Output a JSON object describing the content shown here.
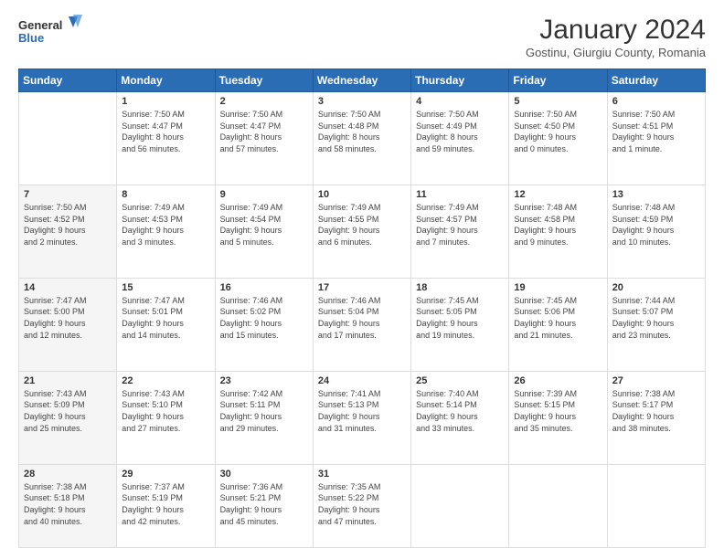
{
  "logo": {
    "line1": "General",
    "line2": "Blue"
  },
  "header": {
    "title": "January 2024",
    "subtitle": "Gostinu, Giurgiu County, Romania"
  },
  "weekdays": [
    "Sunday",
    "Monday",
    "Tuesday",
    "Wednesday",
    "Thursday",
    "Friday",
    "Saturday"
  ],
  "weeks": [
    [
      {
        "day": "",
        "info": ""
      },
      {
        "day": "1",
        "info": "Sunrise: 7:50 AM\nSunset: 4:47 PM\nDaylight: 8 hours\nand 56 minutes."
      },
      {
        "day": "2",
        "info": "Sunrise: 7:50 AM\nSunset: 4:47 PM\nDaylight: 8 hours\nand 57 minutes."
      },
      {
        "day": "3",
        "info": "Sunrise: 7:50 AM\nSunset: 4:48 PM\nDaylight: 8 hours\nand 58 minutes."
      },
      {
        "day": "4",
        "info": "Sunrise: 7:50 AM\nSunset: 4:49 PM\nDaylight: 8 hours\nand 59 minutes."
      },
      {
        "day": "5",
        "info": "Sunrise: 7:50 AM\nSunset: 4:50 PM\nDaylight: 9 hours\nand 0 minutes."
      },
      {
        "day": "6",
        "info": "Sunrise: 7:50 AM\nSunset: 4:51 PM\nDaylight: 9 hours\nand 1 minute."
      }
    ],
    [
      {
        "day": "7",
        "info": "Sunrise: 7:50 AM\nSunset: 4:52 PM\nDaylight: 9 hours\nand 2 minutes."
      },
      {
        "day": "8",
        "info": "Sunrise: 7:49 AM\nSunset: 4:53 PM\nDaylight: 9 hours\nand 3 minutes."
      },
      {
        "day": "9",
        "info": "Sunrise: 7:49 AM\nSunset: 4:54 PM\nDaylight: 9 hours\nand 5 minutes."
      },
      {
        "day": "10",
        "info": "Sunrise: 7:49 AM\nSunset: 4:55 PM\nDaylight: 9 hours\nand 6 minutes."
      },
      {
        "day": "11",
        "info": "Sunrise: 7:49 AM\nSunset: 4:57 PM\nDaylight: 9 hours\nand 7 minutes."
      },
      {
        "day": "12",
        "info": "Sunrise: 7:48 AM\nSunset: 4:58 PM\nDaylight: 9 hours\nand 9 minutes."
      },
      {
        "day": "13",
        "info": "Sunrise: 7:48 AM\nSunset: 4:59 PM\nDaylight: 9 hours\nand 10 minutes."
      }
    ],
    [
      {
        "day": "14",
        "info": "Sunrise: 7:47 AM\nSunset: 5:00 PM\nDaylight: 9 hours\nand 12 minutes."
      },
      {
        "day": "15",
        "info": "Sunrise: 7:47 AM\nSunset: 5:01 PM\nDaylight: 9 hours\nand 14 minutes."
      },
      {
        "day": "16",
        "info": "Sunrise: 7:46 AM\nSunset: 5:02 PM\nDaylight: 9 hours\nand 15 minutes."
      },
      {
        "day": "17",
        "info": "Sunrise: 7:46 AM\nSunset: 5:04 PM\nDaylight: 9 hours\nand 17 minutes."
      },
      {
        "day": "18",
        "info": "Sunrise: 7:45 AM\nSunset: 5:05 PM\nDaylight: 9 hours\nand 19 minutes."
      },
      {
        "day": "19",
        "info": "Sunrise: 7:45 AM\nSunset: 5:06 PM\nDaylight: 9 hours\nand 21 minutes."
      },
      {
        "day": "20",
        "info": "Sunrise: 7:44 AM\nSunset: 5:07 PM\nDaylight: 9 hours\nand 23 minutes."
      }
    ],
    [
      {
        "day": "21",
        "info": "Sunrise: 7:43 AM\nSunset: 5:09 PM\nDaylight: 9 hours\nand 25 minutes."
      },
      {
        "day": "22",
        "info": "Sunrise: 7:43 AM\nSunset: 5:10 PM\nDaylight: 9 hours\nand 27 minutes."
      },
      {
        "day": "23",
        "info": "Sunrise: 7:42 AM\nSunset: 5:11 PM\nDaylight: 9 hours\nand 29 minutes."
      },
      {
        "day": "24",
        "info": "Sunrise: 7:41 AM\nSunset: 5:13 PM\nDaylight: 9 hours\nand 31 minutes."
      },
      {
        "day": "25",
        "info": "Sunrise: 7:40 AM\nSunset: 5:14 PM\nDaylight: 9 hours\nand 33 minutes."
      },
      {
        "day": "26",
        "info": "Sunrise: 7:39 AM\nSunset: 5:15 PM\nDaylight: 9 hours\nand 35 minutes."
      },
      {
        "day": "27",
        "info": "Sunrise: 7:38 AM\nSunset: 5:17 PM\nDaylight: 9 hours\nand 38 minutes."
      }
    ],
    [
      {
        "day": "28",
        "info": "Sunrise: 7:38 AM\nSunset: 5:18 PM\nDaylight: 9 hours\nand 40 minutes."
      },
      {
        "day": "29",
        "info": "Sunrise: 7:37 AM\nSunset: 5:19 PM\nDaylight: 9 hours\nand 42 minutes."
      },
      {
        "day": "30",
        "info": "Sunrise: 7:36 AM\nSunset: 5:21 PM\nDaylight: 9 hours\nand 45 minutes."
      },
      {
        "day": "31",
        "info": "Sunrise: 7:35 AM\nSunset: 5:22 PM\nDaylight: 9 hours\nand 47 minutes."
      },
      {
        "day": "",
        "info": ""
      },
      {
        "day": "",
        "info": ""
      },
      {
        "day": "",
        "info": ""
      }
    ]
  ]
}
